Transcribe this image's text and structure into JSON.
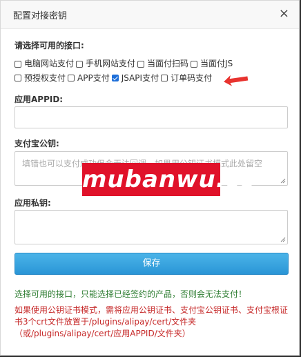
{
  "dialog": {
    "title": "配置对接密钥",
    "close_label": "×"
  },
  "interfaces": {
    "label": "请选择可用的接口:",
    "options": [
      {
        "label": "电脑网站支付",
        "checked": false
      },
      {
        "label": "手机网站支付",
        "checked": false
      },
      {
        "label": "当面付扫码",
        "checked": false
      },
      {
        "label": "当面付JS",
        "checked": false
      },
      {
        "label": "预授权支付",
        "checked": false
      },
      {
        "label": "APP支付",
        "checked": false
      },
      {
        "label": "JSAPI支付",
        "checked": true
      },
      {
        "label": "订单码支付",
        "checked": false
      }
    ]
  },
  "appid": {
    "label": "应用APPID:",
    "value": ""
  },
  "public_key": {
    "label": "支付宝公钥:",
    "placeholder": "填错也可以支付成功但会无法回调，如果用公钥证书模式此处留空"
  },
  "private_key": {
    "label": "应用私钥:",
    "value": ""
  },
  "save_label": "保存",
  "notes": {
    "green": "选择可用的接口，只能选择已经签约的产品，否则会无法支付！",
    "red": "如果使用公钥证书模式，需将应用公钥证书、支付宝公钥证书、支付宝根证书3个crt文件放置于/plugins/alipay/cert/文件夹（或/plugins/alipay/cert/应用APPID/文件夹）"
  },
  "watermark": "mubanwu.cc",
  "colors": {
    "accent": "#2a95d6",
    "checked": "#1e6fd9",
    "note_green": "#2e7d32",
    "note_red": "#c62828",
    "watermark_bg": "#e0122a",
    "arrow": "#e8332f"
  }
}
